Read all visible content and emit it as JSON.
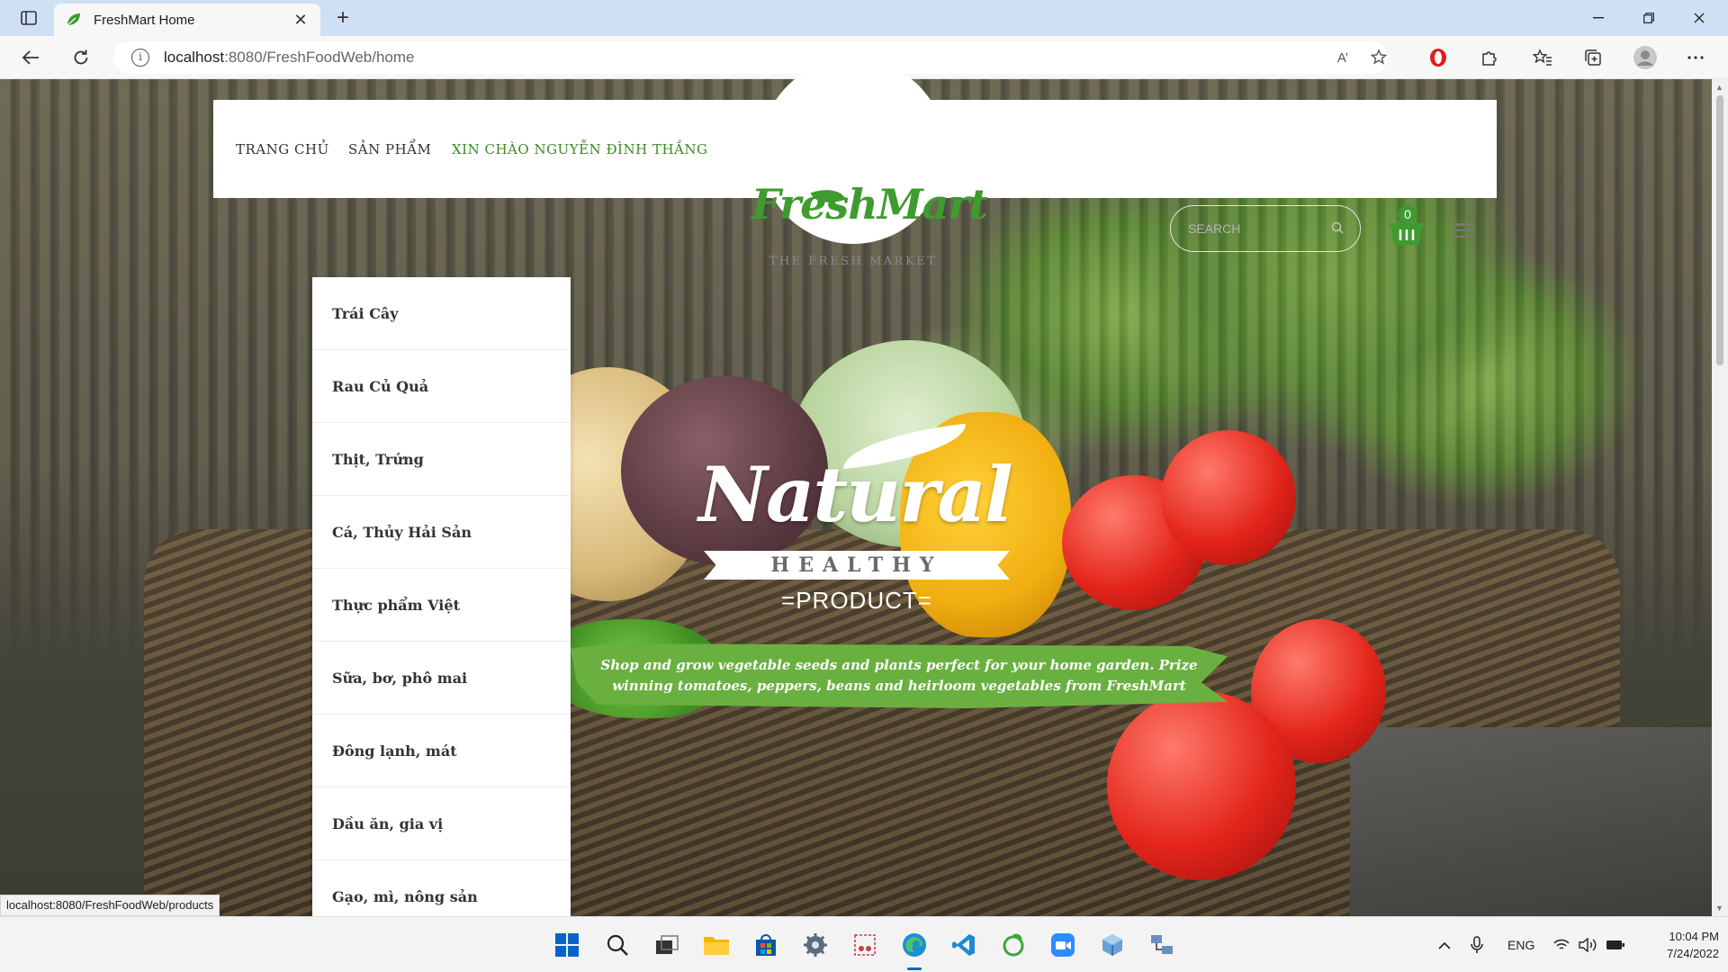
{
  "browser": {
    "tab_title": "FreshMart Home",
    "tab_close": "✕",
    "new_tab": "+",
    "url_host": "localhost",
    "url_path": ":8080/FreshFoodWeb/home",
    "read_aloud": "A’",
    "status_url": "localhost:8080/FreshFoodWeb/products"
  },
  "header": {
    "nav": [
      "TRANG CHỦ",
      "SẢN PHẨM",
      "XIN CHÀO NGUYỄN ĐÌNH THẮNG"
    ],
    "logo": "FreshMart",
    "logo_sub": "THE FRESH MARKET",
    "search_placeholder": "SEARCH",
    "cart_count": "0"
  },
  "dropdown": {
    "items": [
      "Trái Cây",
      "Rau Củ Quả",
      "Thịt, Trứng",
      "Cá, Thủy Hải Sản",
      "Thực phẩm Việt",
      "Sữa, bơ, phô mai",
      "Đông lạnh, mát",
      "Dầu ăn, gia vị",
      "Gạo, mì, nông sản"
    ]
  },
  "hero": {
    "natural": "Natural",
    "healthy": "HEALTHY",
    "product": "=PRODUCT=",
    "tagline": "Shop and grow vegetable seeds and plants perfect for your home garden. Prize winning tomatoes, peppers, beans and heirloom vegetables from FreshMart"
  },
  "taskbar": {
    "lang": "ENG",
    "time": "10:04 PM",
    "date": "7/24/2022"
  },
  "colors": {
    "brand_green": "#3f9b2f",
    "tab_bar": "#cfe0f4"
  }
}
